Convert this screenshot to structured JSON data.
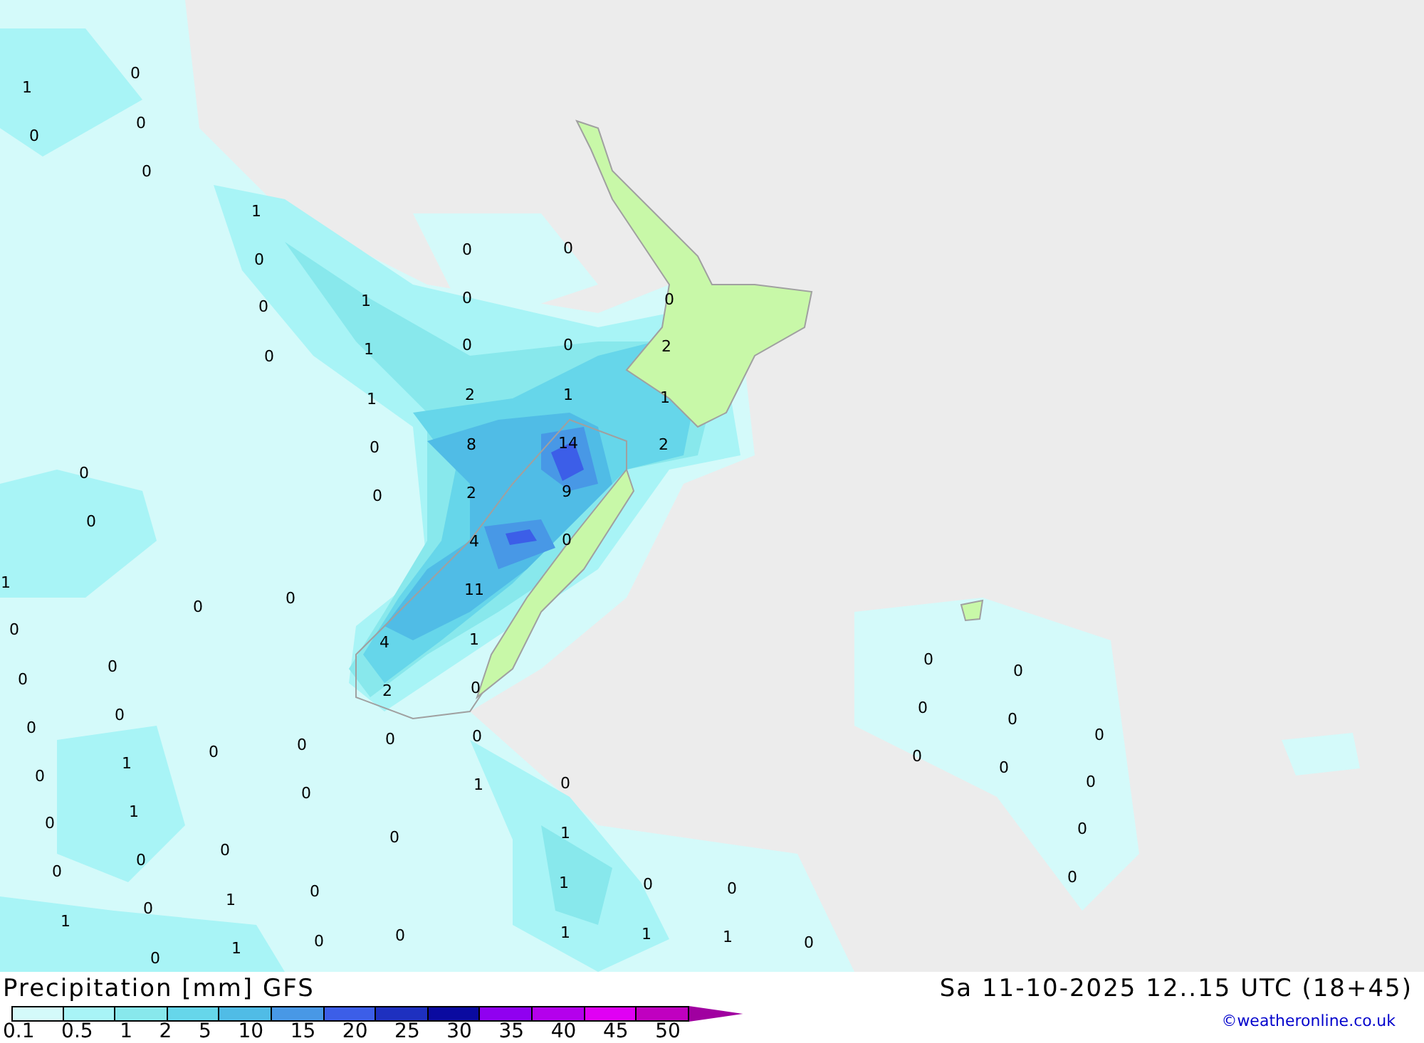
{
  "map": {
    "value_labels": [
      "1",
      "0",
      "0",
      "0",
      "0",
      "1",
      "0",
      "0",
      "0",
      "0",
      "1",
      "0",
      "0",
      "0",
      "1",
      "0",
      "0",
      "2",
      "1",
      "2",
      "1",
      "1",
      "0",
      "8",
      "14",
      "2",
      "0",
      "0",
      "2",
      "9",
      "0",
      "4",
      "0",
      "1",
      "0",
      "0",
      "11",
      "0",
      "0",
      "4",
      "1",
      "0",
      "0",
      "2",
      "0",
      "0",
      "0",
      "0",
      "0",
      "0",
      "0",
      "1",
      "0",
      "1",
      "0",
      "0",
      "1",
      "0",
      "0",
      "1",
      "0",
      "0",
      "0",
      "1",
      "1",
      "0",
      "0",
      "0",
      "1",
      "0",
      "1",
      "0",
      "1",
      "1",
      "1",
      "0",
      "0",
      "0",
      "0",
      "0",
      "0",
      "0",
      "0",
      "0",
      "0",
      "0",
      "0"
    ]
  },
  "legend": {
    "title": "Precipitation [mm] GFS",
    "datetime": "Sa 11-10-2025 12..15 UTC (18+45)",
    "credit": "©weatheronline.co.uk",
    "scale_labels": [
      "0.1",
      "0.5",
      "1",
      "2",
      "5",
      "10",
      "15",
      "20",
      "25",
      "30",
      "35",
      "40",
      "45",
      "50"
    ],
    "scale_colors": [
      {
        "color": "#d4fafa"
      },
      {
        "color": "#a8f4f6"
      },
      {
        "color": "#88e8ec"
      },
      {
        "color": "#66d6ea"
      },
      {
        "color": "#50bce6"
      },
      {
        "color": "#4898e6"
      },
      {
        "color": "#3c5ee8"
      },
      {
        "color": "#1e30c0"
      },
      {
        "color": "#0a0aa0"
      },
      {
        "color": "#9000f0"
      },
      {
        "color": "#b400ec"
      },
      {
        "color": "#e000f4"
      },
      {
        "color": "#c000c0"
      },
      {
        "color": "#a000a0"
      }
    ]
  }
}
